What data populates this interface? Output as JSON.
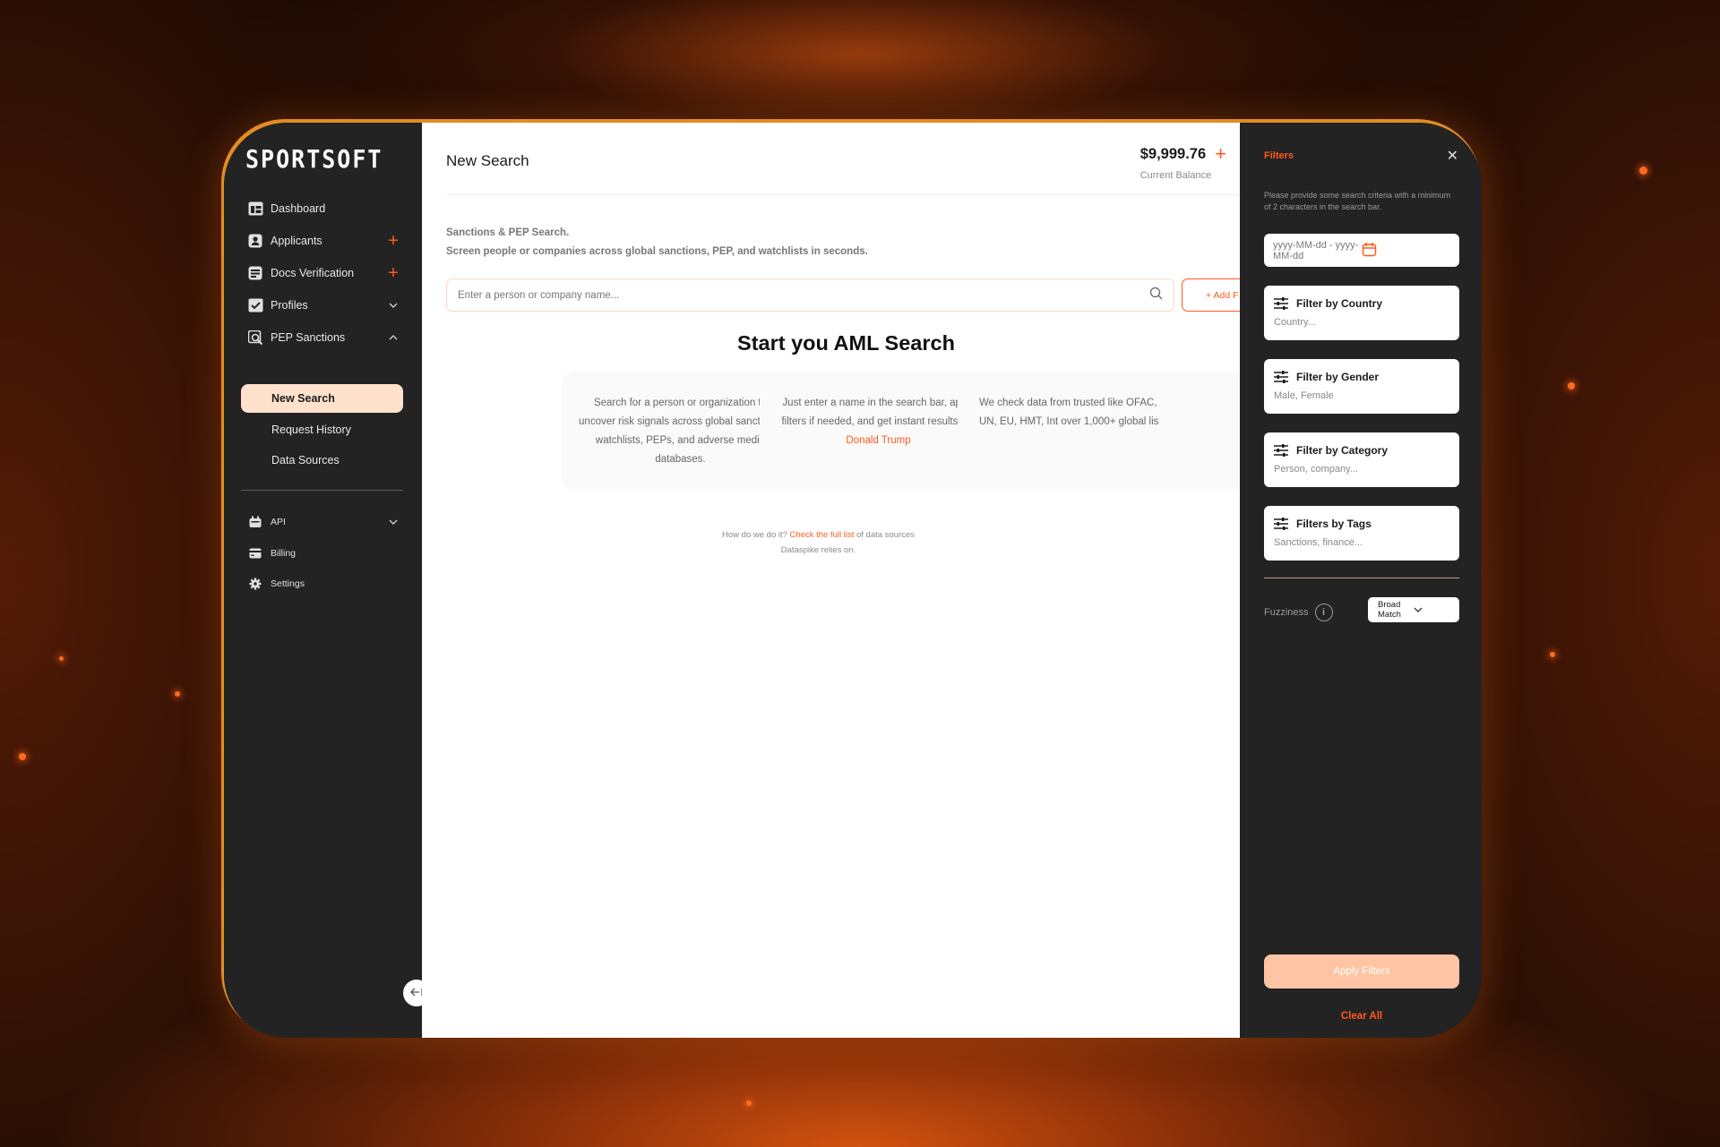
{
  "brand": {
    "logo": "SPORTSOFT"
  },
  "sidebar": {
    "items": [
      {
        "label": "Dashboard",
        "icon": "dashboard-icon"
      },
      {
        "label": "Applicants",
        "icon": "applicant-icon",
        "suffix": "+"
      },
      {
        "label": "Docs Verification",
        "icon": "docs-icon",
        "suffix": "+"
      },
      {
        "label": "Profiles",
        "icon": "profiles-icon"
      },
      {
        "label": "PEP Sanctions",
        "icon": "pep-search-icon"
      }
    ],
    "sub_items": [
      {
        "label": "New Search",
        "active": true
      },
      {
        "label": "Request History"
      },
      {
        "label": "Data Sources"
      }
    ],
    "bottom_items": [
      {
        "label": "API",
        "icon": "api-icon"
      },
      {
        "label": "Billing",
        "icon": "billing-icon"
      },
      {
        "label": "Settings",
        "icon": "gear-icon"
      }
    ],
    "collapse_icon": "collapse-left-icon"
  },
  "header": {
    "title": "New Search",
    "balance": "$9,999.76",
    "balance_add": "+",
    "balance_label": "Current Balance"
  },
  "main": {
    "intro_title": "Sanctions & PEP Search.",
    "intro_text": "Screen people or companies across global sanctions, PEP, and watchlists in seconds.",
    "search_placeholder": "Enter a person or company name...",
    "add_button": "+ Add F",
    "hero": "Start you AML Search",
    "cards": [
      {
        "text": "Search for a person or organization to uncover risk signals across global sanctions, watchlists, PEPs, and adverse media databases."
      },
      {
        "text_before": "Just enter a name in the search bar, apply filters if needed, and get instant results: try",
        "link": "Donald Trump"
      },
      {
        "text": "We check data from trusted like OFAC, UN, EU, HMT, Int over 1,000+ global lis"
      }
    ],
    "footer_before": "How do we do it?",
    "footer_link": "Check the full list",
    "footer_after": "of data sources",
    "footer_line2": "Dataspike relies on."
  },
  "filters": {
    "title": "Filters",
    "close": "✕",
    "hint": "Please provide some search criteria with a minimum of 2 characters in the search bar.",
    "date_placeholder": "yyyy-MM-dd - yyyy-MM-dd",
    "cards": [
      {
        "title": "Filter by Country",
        "sub": "Country..."
      },
      {
        "title": "Filter by Gender",
        "sub": "Male, Female"
      },
      {
        "title": "Filter by Category",
        "sub": "Person, company..."
      },
      {
        "title": "Filters by Tags",
        "sub": "Sanctions, finance..."
      }
    ],
    "fuzziness_label": "Fuzziness",
    "fuzziness_value": "Broad Match",
    "apply": "Apply Filters",
    "clear": "Clear All"
  },
  "colors": {
    "accent": "#ff5a1f",
    "sidebar_bg": "#232323",
    "active_bg": "#ffe1cc"
  }
}
